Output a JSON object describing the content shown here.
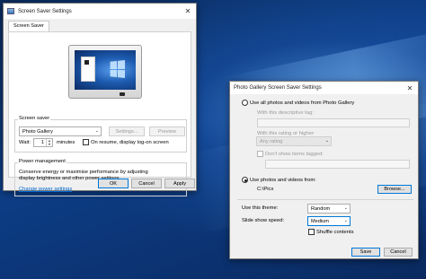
{
  "win1": {
    "title": "Screen Saver Settings",
    "close_glyph": "✕",
    "tab": "Screen Saver",
    "screensaver": {
      "legend": "Screen saver",
      "selected": "Photo Gallery",
      "settings_label": "Settings...",
      "preview_label": "Preview",
      "wait_label": "Wait:",
      "wait_value": "1",
      "minutes_label": "minutes",
      "resume_label": "On resume, display log-on screen"
    },
    "power": {
      "legend": "Power management",
      "text": "Conserve energy or maximise performance by adjusting display brightness and other power settings.",
      "link": "Change power settings"
    },
    "buttons": {
      "ok": "OK",
      "cancel": "Cancel",
      "apply": "Apply"
    }
  },
  "win2": {
    "title": "Photo Gallery Screen Saver Settings",
    "close_glyph": "✕",
    "use_all_label": "Use all photos and videos from Photo Gallery",
    "with_tag_label": "With this descriptive tag:",
    "with_rating_label": "With this rating or higher:",
    "rating_value": "Any rating",
    "dont_show_label": "Don't show items tagged:",
    "use_from_label": "Use photos and videos from:",
    "path": "C:\\Pics",
    "browse_label": "Browse...",
    "theme_label": "Use this theme:",
    "theme_value": "Random",
    "speed_label": "Slide show speed:",
    "speed_value": "Medium",
    "shuffle_label": "Shuffle contents",
    "save_label": "Save",
    "cancel_label": "Cancel"
  },
  "colors": {
    "desktop": "#0d3d86",
    "link": "#0066cc",
    "accent": "#0078d7"
  }
}
